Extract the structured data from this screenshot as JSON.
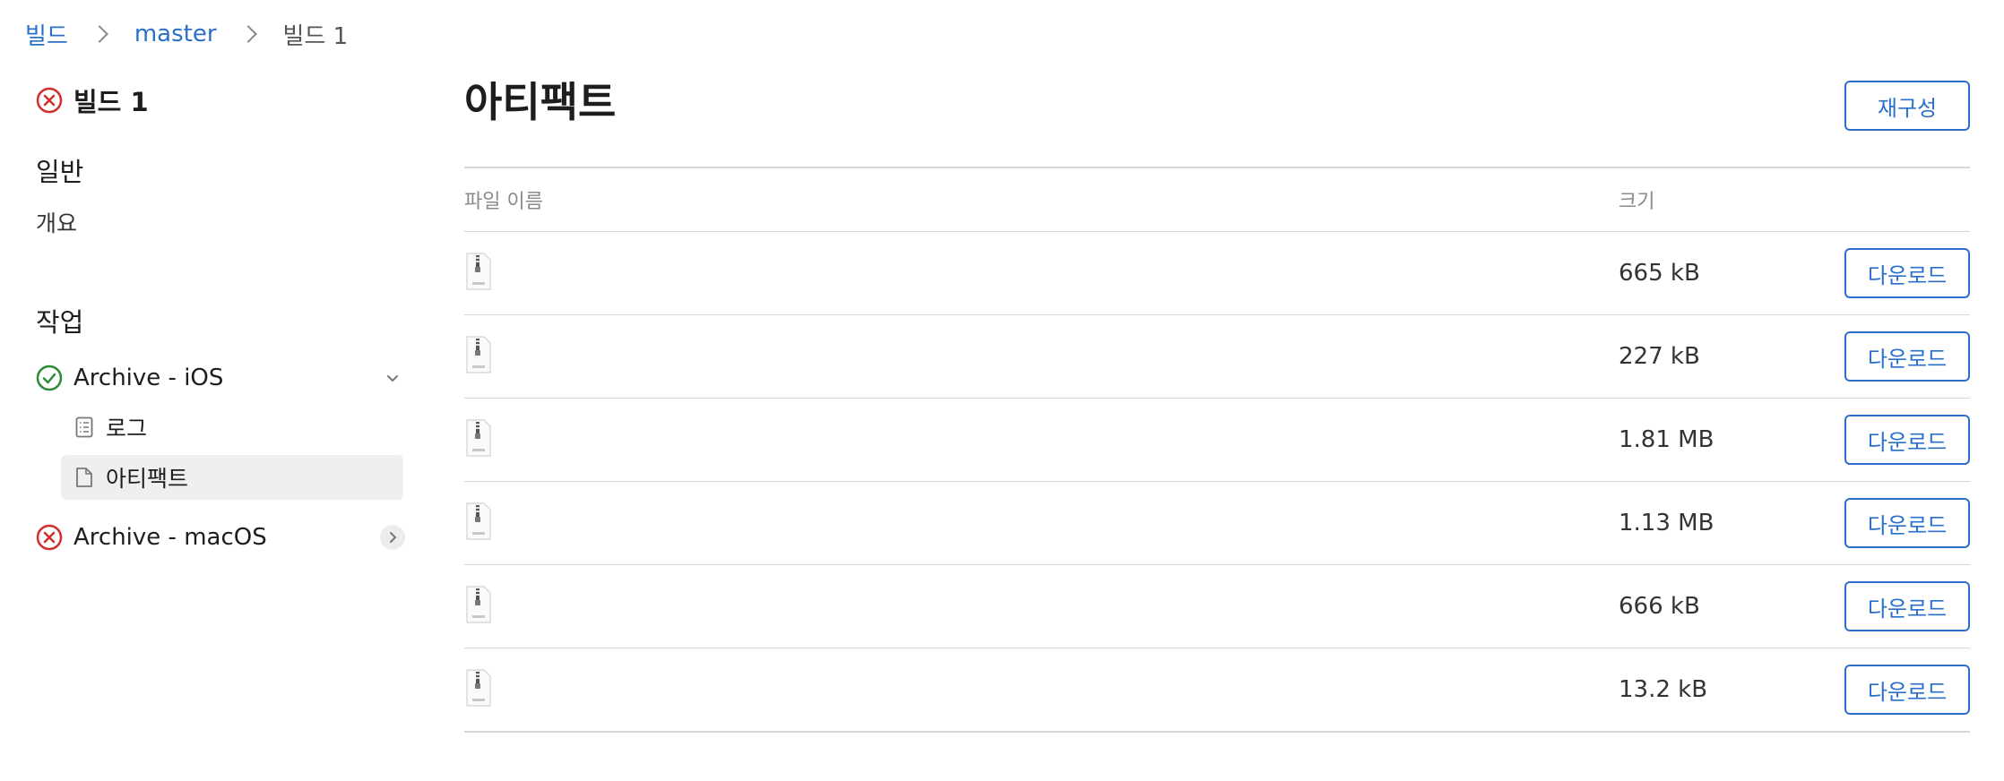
{
  "breadcrumb": {
    "root": "빌드",
    "branch": "master",
    "current": "빌드 1"
  },
  "sidebar": {
    "build_title": "빌드 1",
    "general_title": "일반",
    "overview": "개요",
    "jobs_title": "작업",
    "jobs": [
      {
        "label": "Archive - iOS",
        "status": "success",
        "expanded": true,
        "sub_items": [
          {
            "label": "로그",
            "icon": "log-icon"
          },
          {
            "label": "아티팩트",
            "icon": "document-icon",
            "selected": true
          }
        ]
      },
      {
        "label": "Archive - macOS",
        "status": "failed",
        "expanded": false
      }
    ]
  },
  "main": {
    "title": "아티팩트",
    "rebuild_label": "재구성",
    "columns": {
      "name": "파일 이름",
      "size": "크기"
    },
    "rows": [
      {
        "size": "665 kB",
        "download": "다운로드"
      },
      {
        "size": "227 kB",
        "download": "다운로드"
      },
      {
        "size": "1.81 MB",
        "download": "다운로드"
      },
      {
        "size": "1.13 MB",
        "download": "다운로드"
      },
      {
        "size": "666 kB",
        "download": "다운로드"
      },
      {
        "size": "13.2 kB",
        "download": "다운로드"
      }
    ]
  },
  "colors": {
    "accent": "#2a6fc9",
    "error": "#d0302b",
    "success": "#2e8b3a"
  }
}
